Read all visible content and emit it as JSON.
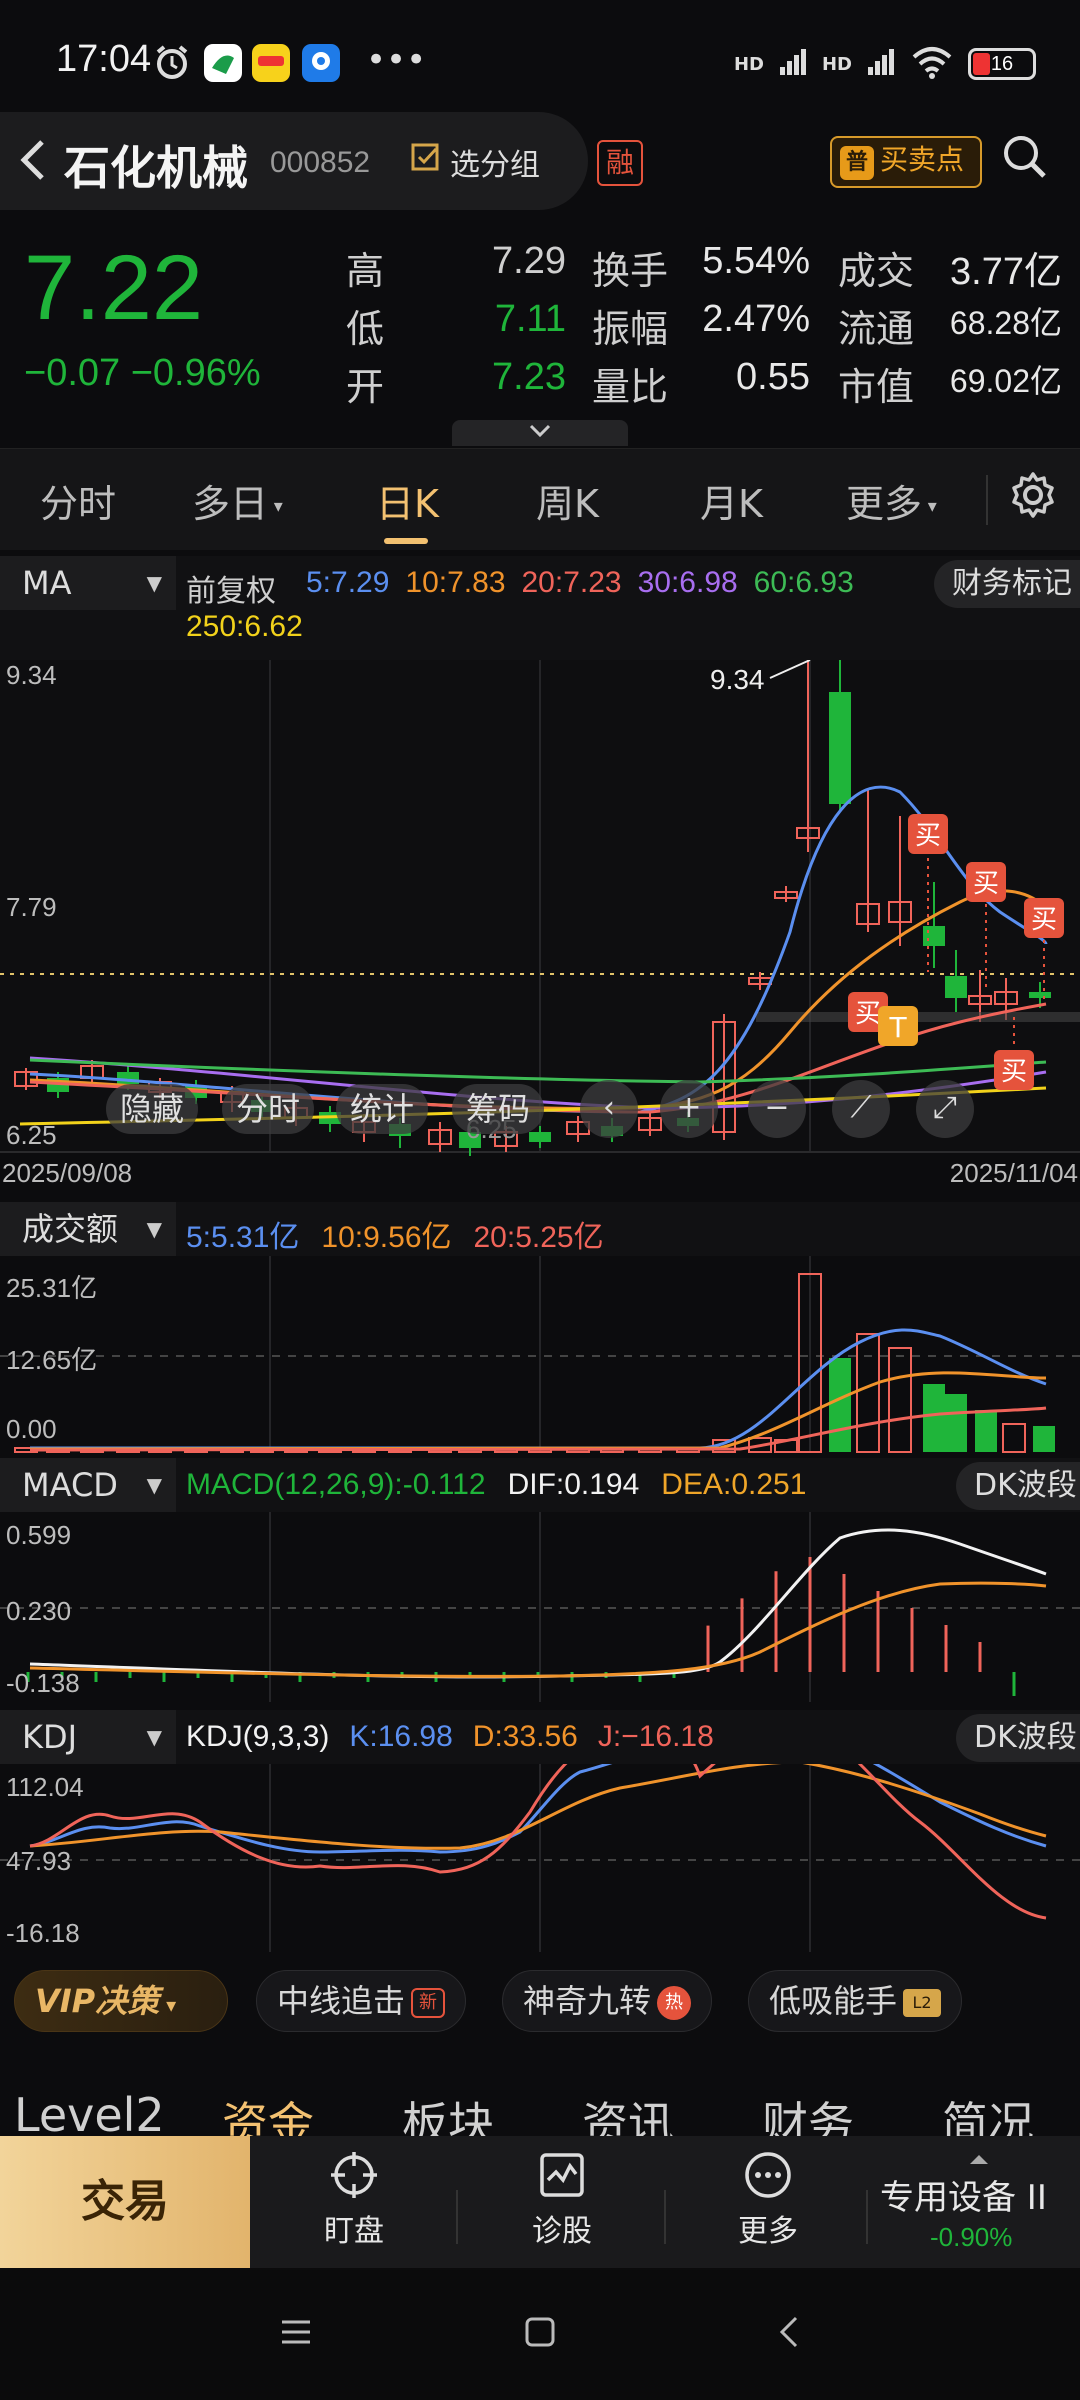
{
  "status": {
    "time": "17:04",
    "battery": "16",
    "sig1": "HD",
    "sig2": "HD"
  },
  "header": {
    "name": "石化机械",
    "code": "000852",
    "group_label": "选分组",
    "rong": "融",
    "buysell_icon": "普",
    "buysell_label": "买卖点"
  },
  "quote": {
    "price": "7.22",
    "change": "−0.07  −0.96%",
    "rows": [
      {
        "l1": "高",
        "v1": "7.29",
        "c1": "#cfcfcf",
        "l2": "换手",
        "v2": "5.54%",
        "l3": "成交",
        "v3": "3.77亿"
      },
      {
        "l1": "低",
        "v1": "7.11",
        "c1": "#1fb53a",
        "l2": "振幅",
        "v2": "2.47%",
        "l3": "流通",
        "v3": "68.28亿"
      },
      {
        "l1": "开",
        "v1": "7.23",
        "c1": "#1fb53a",
        "l2": "量比",
        "v2": "0.55",
        "l3": "市值",
        "v3": "69.02亿"
      }
    ],
    "expand_icon": "chevron-down-icon"
  },
  "tabs": [
    "分时",
    "多日",
    "日K",
    "周K",
    "月K",
    "更多"
  ],
  "active_tab": "日K",
  "ma": {
    "selector": "MA",
    "prefix": "前复权",
    "items": [
      {
        "t": "5:7.29",
        "c": "#5b8ff0"
      },
      {
        "t": "10:7.83",
        "c": "#f0932b"
      },
      {
        "t": "20:7.23",
        "c": "#f0645a"
      },
      {
        "t": "30:6.98",
        "c": "#a86ef0"
      },
      {
        "t": "60:6.93",
        "c": "#3dbb55"
      }
    ],
    "item250": "250:6.62",
    "tag": "财务标记",
    "axis_top": "9.34",
    "axis_mid": "7.79",
    "axis_low": "6.25",
    "high_label": "9.34",
    "low_label": "6.25",
    "date_start": "2025/09/08",
    "date_end": "2025/11/04",
    "buy_mark": "买",
    "t_mark": "T"
  },
  "overlay": {
    "hide": "隐藏",
    "fenshi": "分时",
    "stat": "统计",
    "chips": "筹码"
  },
  "volume": {
    "selector": "成交额",
    "items": [
      {
        "t": "5:5.31亿",
        "c": "#5b8ff0"
      },
      {
        "t": "10:9.56亿",
        "c": "#f0932b"
      },
      {
        "t": "20:5.25亿",
        "c": "#f0645a"
      }
    ],
    "axis_top": "25.31亿",
    "axis_mid": "12.65亿",
    "axis_low": "0.00"
  },
  "macd": {
    "selector": "MACD",
    "items": [
      {
        "t": "MACD(12,26,9):-0.112",
        "c": "#1fb53a"
      },
      {
        "t": "DIF:0.194",
        "c": "#f2f2f2"
      },
      {
        "t": "DEA:0.251",
        "c": "#f0a629"
      }
    ],
    "tag": "DK波段",
    "axis_top": "0.599",
    "axis_mid": "0.230",
    "axis_low": "-0.138"
  },
  "kdj": {
    "selector": "KDJ",
    "items": [
      {
        "t": "KDJ(9,3,3)",
        "c": "#f2f2f2"
      },
      {
        "t": "K:16.98",
        "c": "#5b8ff0"
      },
      {
        "t": "D:33.56",
        "c": "#f0932b"
      },
      {
        "t": "J:−16.18",
        "c": "#f0645a"
      }
    ],
    "tag": "DK波段",
    "axis_top": "112.04",
    "axis_mid": "47.93",
    "axis_low": "-16.18"
  },
  "vip": {
    "vip_label": "VIP决策",
    "p1": "中线追击",
    "p1_badge": "新",
    "p2": "神奇九转",
    "p2_badge": "热",
    "p3": "低吸能手",
    "p3_badge": "L2"
  },
  "info_tabs": [
    "Level2",
    "资金",
    "板块",
    "资讯",
    "财务",
    "简况"
  ],
  "actions": {
    "trade": "交易",
    "watch": "盯盘",
    "diagnose": "诊股",
    "more": "更多",
    "sector": "专用设备 II",
    "sector_change": "-0.90%"
  },
  "colors": {
    "up": "#f0645a",
    "down": "#1fb53a",
    "accent": "#f3c171",
    "ma5": "#5b8ff0",
    "ma10": "#f0932b",
    "ma20": "#f0645a",
    "ma30": "#a86ef0",
    "ma60": "#3dbb55",
    "ma250": "#f2d21b"
  }
}
